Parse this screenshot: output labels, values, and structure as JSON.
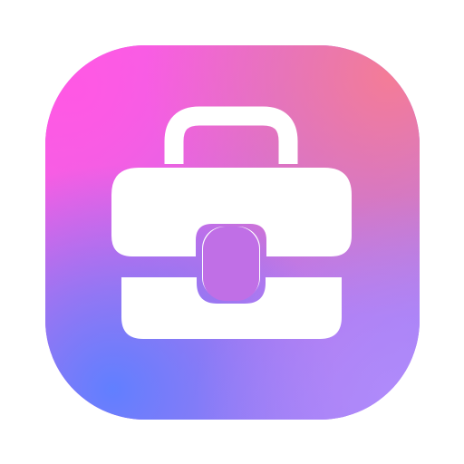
{
  "icon": {
    "name": "briefcase-icon",
    "background_colors": {
      "top_left": "#ff59e0",
      "top_right": "#f57a9c",
      "middle": "#c77ae6",
      "bottom_left": "#6b80ff",
      "bottom_right": "#ab87fa"
    },
    "glyph_color": "#ffffff"
  }
}
